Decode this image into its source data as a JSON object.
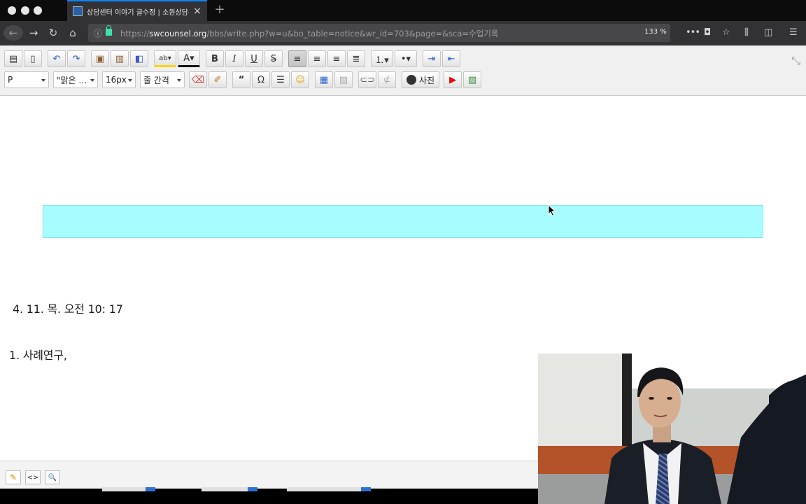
{
  "browser": {
    "tab": {
      "title": "상담센터 이야기 글수정 | 소원상담센터",
      "close": "×"
    },
    "new_tab": "+",
    "url": {
      "prefix": "https://",
      "host": "swcounsel.org",
      "path": "/bbs/write.php?w=u&bo_table=notice&wr_id=703&page=&sca=수업기록"
    },
    "zoom": "133 %",
    "more": "•••"
  },
  "toolbar": {
    "paragraph_select": "P",
    "font_select": "\"맑은 …",
    "size_select": "16px",
    "line_height_select": "줄 간격",
    "bold": "B",
    "italic": "I",
    "underline": "U",
    "strike": "S",
    "quote": "“",
    "omega": "Ω",
    "photo": "사진"
  },
  "document": {
    "line1": "4. 11. 목. 오전 10: 17",
    "line2": "1. 사례연구,"
  },
  "colors": {
    "highlight_bar": "#a6fcff",
    "accent": "#0a84ff"
  },
  "mode_buttons": [
    "✎",
    "<>",
    "🔍"
  ]
}
